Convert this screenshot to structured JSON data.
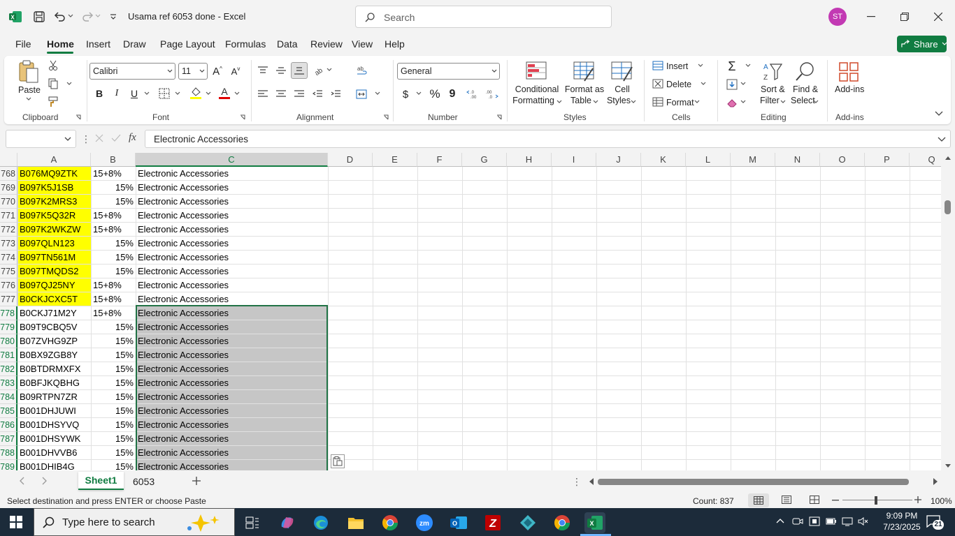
{
  "window": {
    "title": "Usama ref 6053 done  -  Excel",
    "search_placeholder": "Search",
    "avatar_initials": "ST"
  },
  "menu_tabs": [
    "File",
    "Home",
    "Insert",
    "Draw",
    "Page Layout",
    "Formulas",
    "Data",
    "Review",
    "View",
    "Help"
  ],
  "active_tab": "Home",
  "share_label": "Share",
  "ribbon": {
    "clipboard": {
      "label": "Clipboard",
      "paste": "Paste"
    },
    "font": {
      "label": "Font",
      "name": "Calibri",
      "size": "11",
      "bold": "B",
      "italic": "I",
      "underline": "U"
    },
    "alignment": {
      "label": "Alignment"
    },
    "number": {
      "label": "Number",
      "format": "General"
    },
    "styles": {
      "label": "Styles",
      "conditional": "Conditional",
      "conditional2": "Formatting",
      "format_as": "Format as",
      "format_as2": "Table",
      "cell": "Cell",
      "cell2": "Styles"
    },
    "cells": {
      "label": "Cells",
      "insert": "Insert",
      "delete": "Delete",
      "format": "Format"
    },
    "editing": {
      "label": "Editing",
      "sort": "Sort &",
      "sort2": "Filter",
      "find": "Find &",
      "find2": "Select"
    },
    "addins": {
      "label": "Add-ins",
      "btn": "Add-ins"
    }
  },
  "formula_bar": {
    "name_box": "",
    "fx": "fx",
    "content": "Electronic Accessories"
  },
  "columns": [
    "A",
    "B",
    "C",
    "D",
    "E",
    "F",
    "G",
    "H",
    "I",
    "J",
    "K",
    "L",
    "M",
    "N",
    "O",
    "P",
    "Q"
  ],
  "rows": [
    {
      "num": "768",
      "a": "B076MQ9ZTK",
      "b": "15+8%",
      "c": "Electronic Accessories"
    },
    {
      "num": "769",
      "a": "B097K5J1SB",
      "b": "15%",
      "c": "Electronic Accessories"
    },
    {
      "num": "770",
      "a": "B097K2MRS3",
      "b": "15%",
      "c": "Electronic Accessories"
    },
    {
      "num": "771",
      "a": "B097K5Q32R",
      "b": "15+8%",
      "c": "Electronic Accessories"
    },
    {
      "num": "772",
      "a": "B097K2WKZW",
      "b": "15+8%",
      "c": "Electronic Accessories"
    },
    {
      "num": "773",
      "a": "B097QLN123",
      "b": "15%",
      "c": "Electronic Accessories"
    },
    {
      "num": "774",
      "a": "B097TN561M",
      "b": "15%",
      "c": "Electronic Accessories"
    },
    {
      "num": "775",
      "a": "B097TMQDS2",
      "b": "15%",
      "c": "Electronic Accessories"
    },
    {
      "num": "776",
      "a": "B097QJ25NY",
      "b": "15+8%",
      "c": "Electronic Accessories"
    },
    {
      "num": "777",
      "a": "B0CKJCXC5T",
      "b": "15+8%",
      "c": "Electronic Accessories"
    },
    {
      "num": "778",
      "a": "B0CKJ71M2Y",
      "b": "15+8%",
      "c": "Electronic Accessories"
    },
    {
      "num": "779",
      "a": "B09T9CBQ5V",
      "b": "15%",
      "c": "Electronic Accessories"
    },
    {
      "num": "780",
      "a": "B07ZVHG9ZP",
      "b": "15%",
      "c": "Electronic Accessories"
    },
    {
      "num": "781",
      "a": "B0BX9ZGB8Y",
      "b": "15%",
      "c": "Electronic Accessories"
    },
    {
      "num": "782",
      "a": "B0BTDRMXFX",
      "b": "15%",
      "c": "Electronic Accessories"
    },
    {
      "num": "783",
      "a": "B0BFJKQBHG",
      "b": "15%",
      "c": "Electronic Accessories"
    },
    {
      "num": "784",
      "a": "B09RTPN7ZR",
      "b": "15%",
      "c": "Electronic Accessories"
    },
    {
      "num": "785",
      "a": "B001DHJUWI",
      "b": "15%",
      "c": "Electronic Accessories"
    },
    {
      "num": "786",
      "a": "B001DHSYVQ",
      "b": "15%",
      "c": "Electronic Accessories"
    },
    {
      "num": "787",
      "a": "B001DHSYWK",
      "b": "15%",
      "c": "Electronic Accessories"
    },
    {
      "num": "788",
      "a": "B001DHVVB6",
      "b": "15%",
      "c": "Electronic Accessories"
    },
    {
      "num": "789",
      "a": "B001DHIB4G",
      "b": "15%",
      "c": "Electronic Accessories"
    }
  ],
  "sheets": [
    "Sheet1",
    "6053"
  ],
  "status": {
    "message": "Select destination and press ENTER or choose Paste",
    "count": "Count: 837",
    "zoom": "100%"
  },
  "taskbar": {
    "search_placeholder": "Type here to search",
    "time": "9:09 PM",
    "date": "7/23/2025",
    "notifications": "21"
  },
  "colors": {
    "excel_green": "#107c41",
    "highlight_yellow": "#ffff00",
    "selection_gray": "#c6c6c6"
  }
}
